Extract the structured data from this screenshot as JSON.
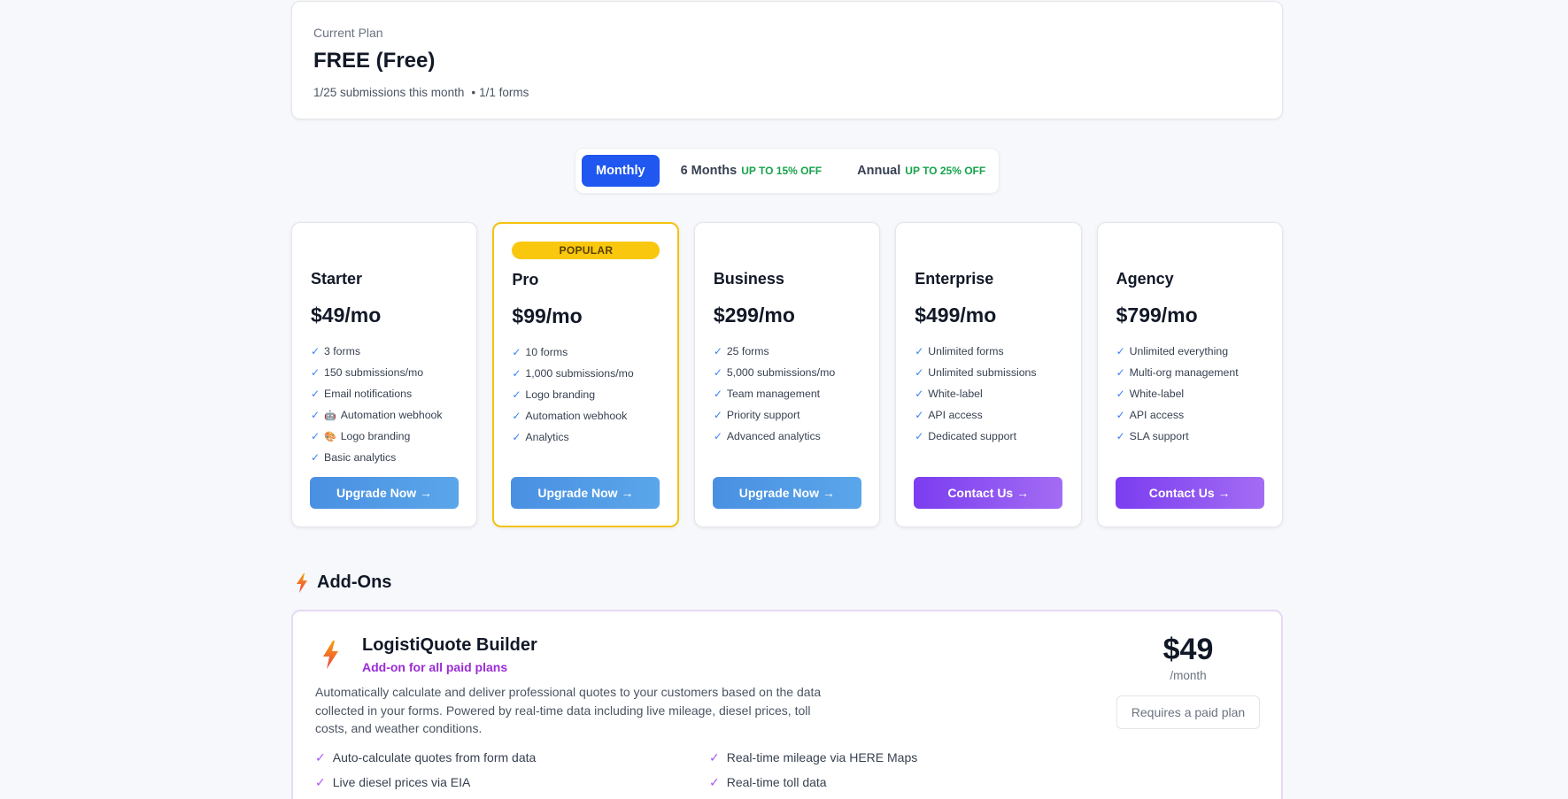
{
  "current": {
    "label": "Current Plan",
    "plan": "FREE (Free)",
    "submissions": "1/25 submissions this month",
    "separator": "•",
    "forms": "1/1 forms"
  },
  "billing": {
    "options": [
      {
        "label": "Monthly",
        "discount": "",
        "active": true
      },
      {
        "label": "6 Months",
        "discount": "UP TO 15% OFF",
        "active": false
      },
      {
        "label": "Annual",
        "discount": "UP TO 25% OFF",
        "active": false
      }
    ]
  },
  "plans": [
    {
      "name": "Starter",
      "price": "$49/mo",
      "popular": false,
      "features": [
        "3 forms",
        "150 submissions/mo",
        "Email notifications",
        "Automation webhook",
        "Logo branding",
        "Basic analytics"
      ],
      "button": "Upgrade Now →"
    },
    {
      "name": "Pro",
      "price": "$99/mo",
      "popular": true,
      "badge": "POPULAR",
      "features": [
        "10 forms",
        "1,000 submissions/mo",
        "Logo branding",
        "Automation webhook",
        "Analytics"
      ],
      "button": "Upgrade Now →"
    },
    {
      "name": "Business",
      "price": "$299/mo",
      "popular": false,
      "features": [
        "25 forms",
        "5,000 submissions/mo",
        "Team management",
        "Priority support",
        "Advanced analytics"
      ],
      "button": "Upgrade Now →"
    },
    {
      "name": "Enterprise",
      "price": "$499/mo",
      "popular": false,
      "features": [
        "Unlimited forms",
        "Unlimited submissions",
        "White-label",
        "API access",
        "Dedicated support"
      ],
      "button": "Contact Us →"
    },
    {
      "name": "Agency",
      "price": "$799/mo",
      "popular": false,
      "features": [
        "Unlimited everything",
        "Multi-org management",
        "White-label",
        "API access",
        "SLA support"
      ],
      "button": "Contact Us →"
    }
  ],
  "addons": {
    "title": "Add-Ons",
    "card": {
      "name": "LogistiQuote Builder",
      "subtitle": "Add-on for all paid plans",
      "description": "Automatically calculate and deliver professional quotes to your customers based on the data collected in your forms. Powered by real-time data including live mileage, diesel prices, toll costs, and weather conditions.",
      "features": [
        "Auto-calculate quotes from form data",
        "Real-time mileage via HERE Maps",
        "Live diesel prices via EIA",
        "Real-time toll data"
      ],
      "price": "$49",
      "period": "/month",
      "requirement": "Requires a paid plan"
    }
  },
  "colors": {
    "primary_blue": "#1f57f0",
    "popular_gold": "#f9c80e",
    "discount_green": "#16a34a",
    "addon_purple": "#9b2bd6"
  },
  "icons": {
    "check": "check-icon",
    "bolt": "lightning-bolt-icon",
    "webhook_emoji": "robot-emoji-icon",
    "branding_emoji": "palette-emoji-icon"
  }
}
